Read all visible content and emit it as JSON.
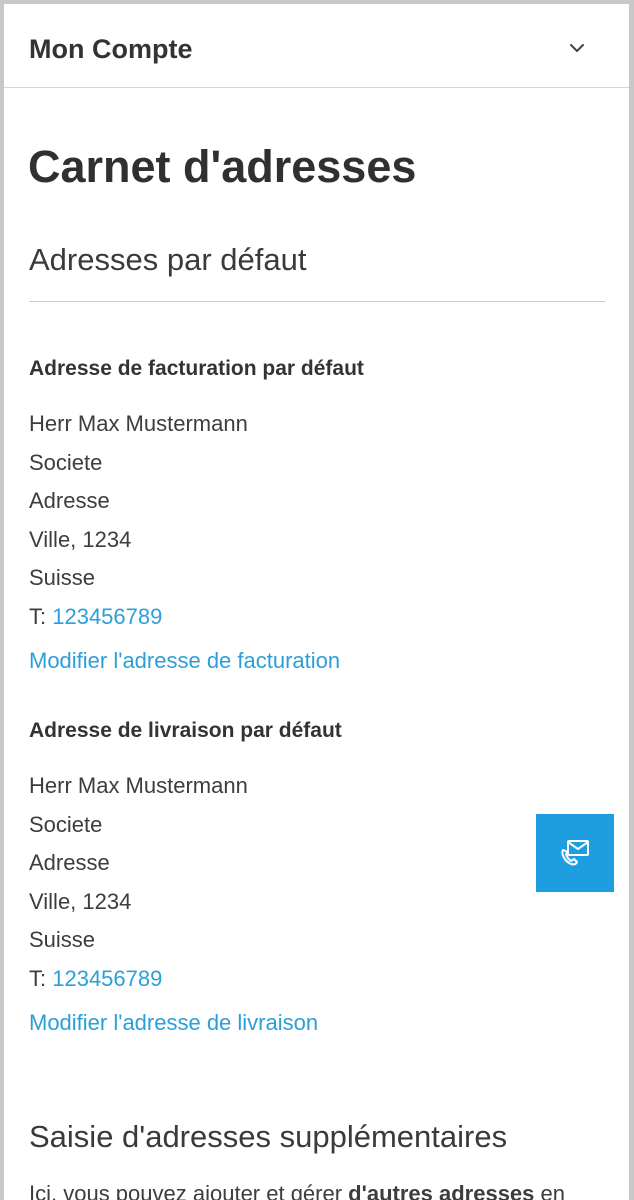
{
  "header": {
    "account_label": "Mon Compte",
    "toggle_icon": "chevron-down-icon"
  },
  "page": {
    "title": "Carnet d'adresses"
  },
  "default_section": {
    "title": "Adresses par défaut"
  },
  "billing": {
    "title": "Adresse de facturation par défaut",
    "name": "Herr Max Mustermann",
    "company": "Societe",
    "street": "Adresse",
    "city": "Ville, 1234",
    "country": "Suisse",
    "phone_prefix": "T: ",
    "phone": "123456789",
    "edit_link": "Modifier l'adresse de facturation"
  },
  "shipping": {
    "title": "Adresse de livraison par défaut",
    "name": "Herr Max Mustermann",
    "company": "Societe",
    "street": "Adresse",
    "city": "Ville, 1234",
    "country": "Suisse",
    "phone_prefix": "T: ",
    "phone": "123456789",
    "edit_link": "Modifier l'adresse de livraison"
  },
  "additional_section": {
    "title": "Saisie d'adresses supplémentaires",
    "text_start": "Ici, vous pouvez ajouter et gérer ",
    "text_bold": "d'autres adresses",
    "text_end": " en"
  },
  "contact_button": {
    "icon": "mail-phone-icon",
    "color": "#1e9ee0"
  },
  "colors": {
    "link": "#2c9fd9",
    "text": "#333333"
  }
}
